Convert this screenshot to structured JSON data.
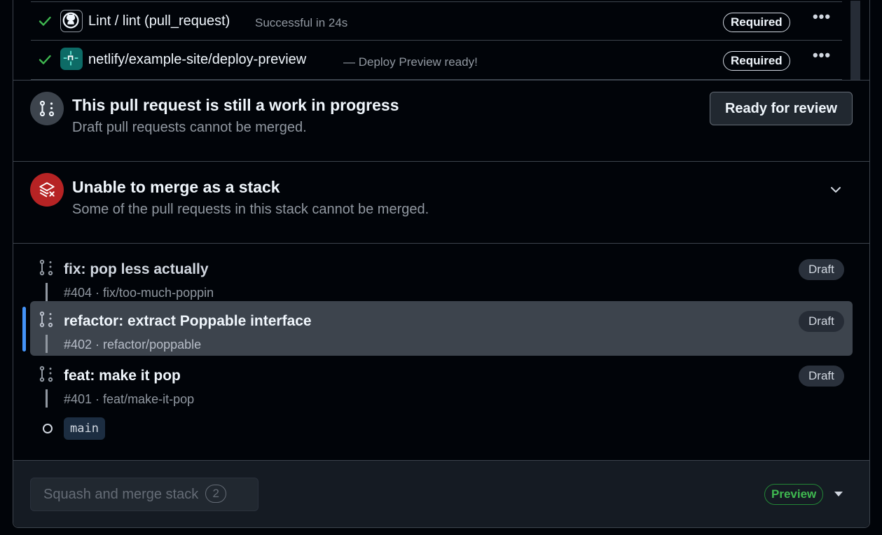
{
  "checks": [
    {
      "name": "Lint / lint (pull_request)",
      "status": "Successful in 24s",
      "badge": "Required",
      "icon": "github-icon",
      "more": "•••"
    },
    {
      "name": "netlify/example-site/deploy-preview",
      "status": "— Deploy Preview ready!",
      "badge": "Required",
      "icon": "netlify-icon",
      "more": "•••"
    }
  ],
  "draft_notice": {
    "title": "This pull request is still a work in progress",
    "subtitle": "Draft pull requests cannot be merged.",
    "button": "Ready for review"
  },
  "stack_notice": {
    "title": "Unable to merge as a stack",
    "subtitle": "Some of the pull requests in this stack cannot be merged."
  },
  "stack": {
    "items": [
      {
        "title": "fix: pop less actually",
        "meta": "#404 · fix/too-much-poppin",
        "badge": "Draft"
      },
      {
        "title": "refactor: extract Poppable interface",
        "meta": "#402 · refactor/poppable",
        "badge": "Draft",
        "active": true
      },
      {
        "title": "feat: make it pop",
        "meta": "#401 · feat/make-it-pop",
        "badge": "Draft"
      }
    ],
    "base": "main"
  },
  "merge": {
    "button": "Squash and merge stack",
    "count": "2",
    "preview": "Preview"
  },
  "colors": {
    "success": "#3fb950",
    "danger": "#b62324",
    "accent": "#4493f8",
    "netlify": "#0d6b66"
  }
}
